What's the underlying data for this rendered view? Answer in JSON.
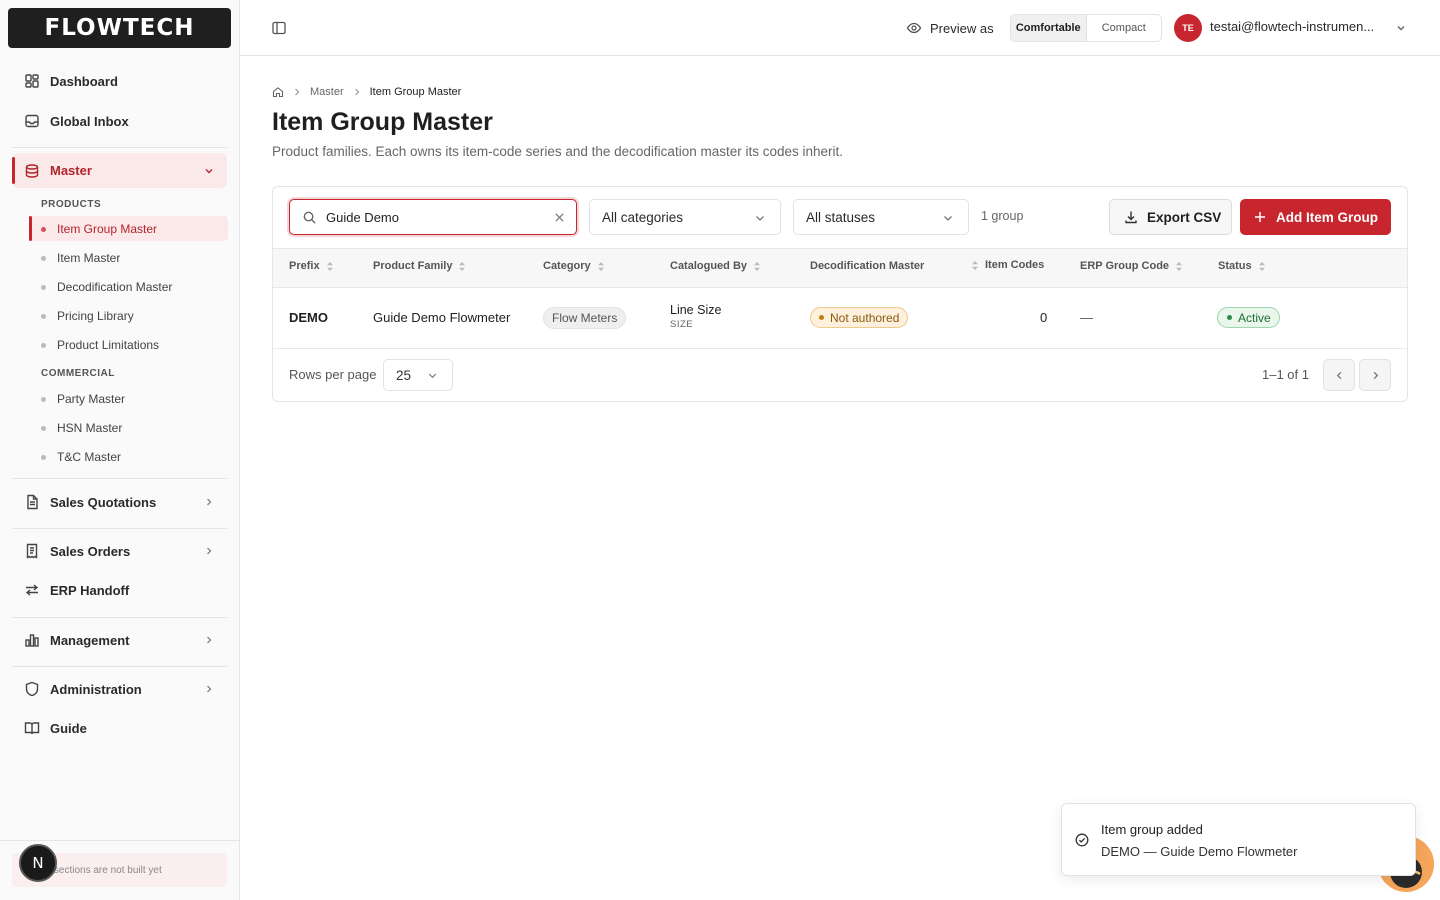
{
  "app": {
    "logo_text": "FLOWTECH",
    "brand_color": "#c8262e"
  },
  "sidebar": {
    "dashboard": "Dashboard",
    "global_inbox": "Global Inbox",
    "master": "Master",
    "products_label": "PRODUCTS",
    "products": [
      "Item Group Master",
      "Item Master",
      "Decodification Master",
      "Pricing Library",
      "Product Limitations"
    ],
    "commercial_label": "COMMERCIAL",
    "commercial": [
      "Party Master",
      "HSN Master",
      "T&C Master"
    ],
    "sales_quotations": "Sales Quotations",
    "sales_orders": "Sales Orders",
    "erp_handoff": "ERP Handoff",
    "management": "Management",
    "administration": "Administration",
    "guide": "Guide",
    "footer_note": "ed sections are not built yet",
    "n_badge": "N"
  },
  "topbar": {
    "preview_as": "Preview as",
    "density_comfortable": "Comfortable",
    "density_compact": "Compact",
    "avatar_initials": "TE",
    "user_email": "testai@flowtech-instrumen..."
  },
  "breadcrumb": {
    "parent": "Master",
    "current": "Item Group Master"
  },
  "page": {
    "title": "Item Group Master",
    "subtitle": "Product families. Each owns its item-code series and the decodification master its codes inherit."
  },
  "toolbar": {
    "search_value": "Guide Demo",
    "category_filter": "All categories",
    "status_filter": "All statuses",
    "group_count": "1 group",
    "export_label": "Export CSV",
    "add_label": "Add Item Group"
  },
  "table": {
    "columns": [
      "Prefix",
      "Product Family",
      "Category",
      "Catalogued By",
      "Decodification Master",
      "Item Codes",
      "ERP Group Code",
      "Status"
    ],
    "rows": [
      {
        "prefix": "DEMO",
        "family": "Guide Demo Flowmeter",
        "category": "Flow Meters",
        "catalogued_by": "Line Size",
        "catalogued_by_sub": "SIZE",
        "decodification": "Not authored",
        "item_codes": "0",
        "erp_group_code": "—",
        "status": "Active"
      }
    ]
  },
  "pagination": {
    "rows_label": "Rows per page",
    "rows_value": "25",
    "range": "1–1 of 1"
  },
  "toast": {
    "title": "Item group added",
    "description": "DEMO — Guide Demo Flowmeter"
  }
}
